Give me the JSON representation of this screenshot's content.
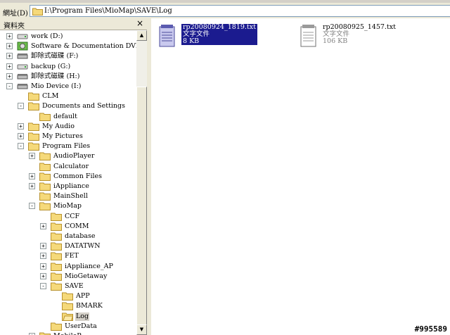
{
  "address": {
    "label": "網址(D)",
    "path": "I:\\Program Files\\MioMap\\SAVE\\Log"
  },
  "folders_pane": {
    "title": "資料夾",
    "close": "×"
  },
  "tree": [
    {
      "label": "work (D:)",
      "icon": "drive",
      "level": 0,
      "expander": "+"
    },
    {
      "label": "Software & Documentation DVD (E",
      "icon": "dvd",
      "level": 0,
      "expander": "+"
    },
    {
      "label": "卸除式磁碟 (F:)",
      "icon": "removable",
      "level": 0,
      "expander": "+"
    },
    {
      "label": "backup (G:)",
      "icon": "drive",
      "level": 0,
      "expander": "+"
    },
    {
      "label": "卸除式磁碟 (H:)",
      "icon": "removable",
      "level": 0,
      "expander": "+"
    },
    {
      "label": "Mio Device (I:)",
      "icon": "removable",
      "level": 0,
      "expander": "-"
    },
    {
      "label": "CLM",
      "icon": "folder",
      "level": 1,
      "expander": ""
    },
    {
      "label": "Documents and Settings",
      "icon": "folder",
      "level": 1,
      "expander": "-"
    },
    {
      "label": "default",
      "icon": "folder",
      "level": 2,
      "expander": ""
    },
    {
      "label": "My Audio",
      "icon": "folder",
      "level": 1,
      "expander": "+"
    },
    {
      "label": "My Pictures",
      "icon": "folder",
      "level": 1,
      "expander": "+"
    },
    {
      "label": "Program Files",
      "icon": "folder",
      "level": 1,
      "expander": "-"
    },
    {
      "label": "AudioPlayer",
      "icon": "folder",
      "level": 2,
      "expander": "+"
    },
    {
      "label": "Calculator",
      "icon": "folder",
      "level": 2,
      "expander": ""
    },
    {
      "label": "Common Files",
      "icon": "folder",
      "level": 2,
      "expander": "+"
    },
    {
      "label": "iAppliance",
      "icon": "folder",
      "level": 2,
      "expander": "+"
    },
    {
      "label": "MainShell",
      "icon": "folder",
      "level": 2,
      "expander": ""
    },
    {
      "label": "MioMap",
      "icon": "folder",
      "level": 2,
      "expander": "-"
    },
    {
      "label": "CCF",
      "icon": "folder",
      "level": 3,
      "expander": ""
    },
    {
      "label": "COMM",
      "icon": "folder",
      "level": 3,
      "expander": "+"
    },
    {
      "label": "database",
      "icon": "folder",
      "level": 3,
      "expander": ""
    },
    {
      "label": "DATATWN",
      "icon": "folder",
      "level": 3,
      "expander": "+"
    },
    {
      "label": "FET",
      "icon": "folder",
      "level": 3,
      "expander": "+"
    },
    {
      "label": "iAppliance_AP",
      "icon": "folder",
      "level": 3,
      "expander": "+"
    },
    {
      "label": "MioGetaway",
      "icon": "folder",
      "level": 3,
      "expander": "+"
    },
    {
      "label": "SAVE",
      "icon": "folder",
      "level": 3,
      "expander": "-"
    },
    {
      "label": "APP",
      "icon": "folder",
      "level": 4,
      "expander": ""
    },
    {
      "label": "BMARK",
      "icon": "folder",
      "level": 4,
      "expander": ""
    },
    {
      "label": "Log",
      "icon": "folder-open",
      "level": 4,
      "expander": "",
      "selected": true
    },
    {
      "label": "UserData",
      "icon": "folder",
      "level": 3,
      "expander": ""
    },
    {
      "label": "MobileP...",
      "icon": "folder",
      "level": 2,
      "expander": "+"
    }
  ],
  "files": [
    {
      "name": "rp20080924_1819.txt",
      "type": "文字文件",
      "size": "8 KB",
      "icon": "notepad-document-icon",
      "selected": true
    },
    {
      "name": "rp20080925_1457.txt",
      "type": "文字文件",
      "size": "106 KB",
      "icon": "notepad-document-icon",
      "selected": false
    }
  ],
  "watermark": "#995589",
  "colors": {
    "selection": "#1b1b8f",
    "folder_yellow": "#f5d97a",
    "chrome": "#ece9d8"
  }
}
